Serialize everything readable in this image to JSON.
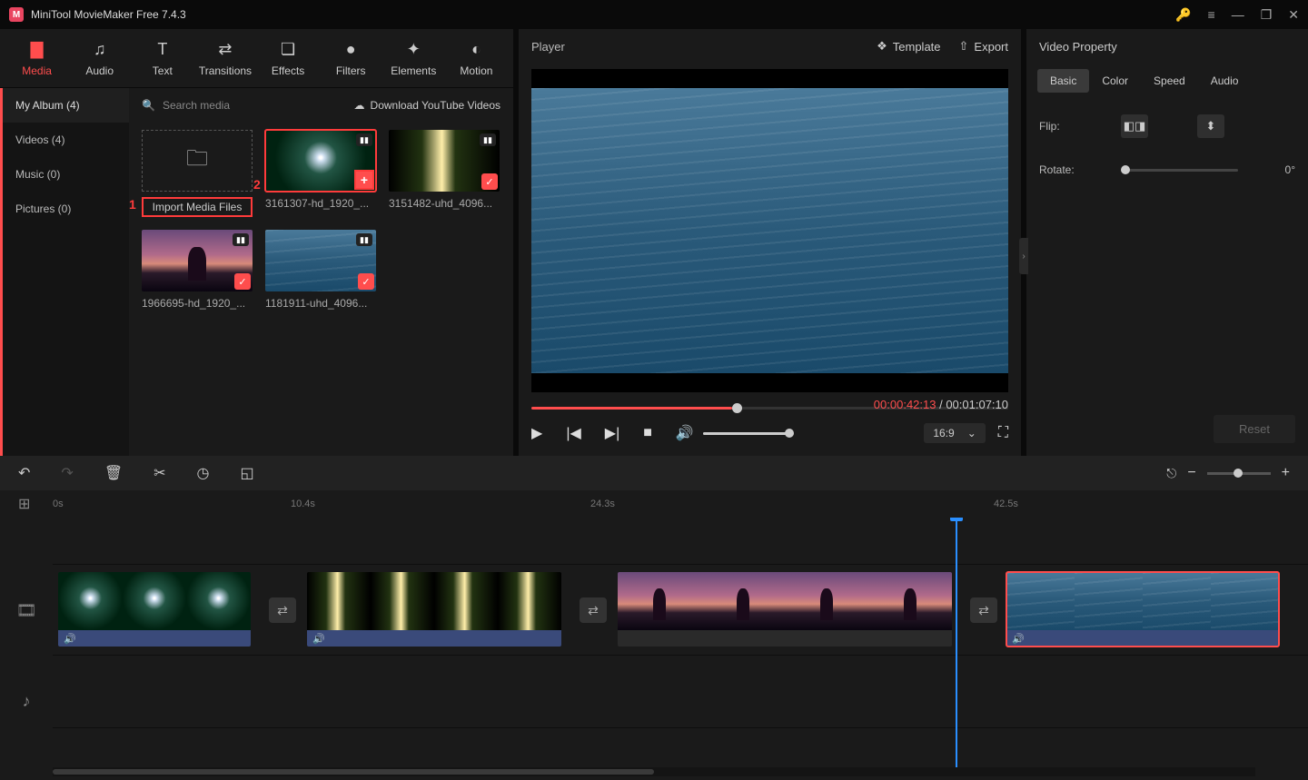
{
  "app": {
    "title": "MiniTool MovieMaker Free 7.4.3"
  },
  "topTabs": {
    "media": "Media",
    "audio": "Audio",
    "text": "Text",
    "transitions": "Transitions",
    "effects": "Effects",
    "filters": "Filters",
    "elements": "Elements",
    "motion": "Motion"
  },
  "sidebar": {
    "myAlbum": "My Album (4)",
    "videos": "Videos (4)",
    "music": "Music (0)",
    "pictures": "Pictures (0)"
  },
  "mediaHeader": {
    "searchPlaceholder": "Search media",
    "download": "Download YouTube Videos"
  },
  "mediaItems": {
    "import": "Import Media Files",
    "annot1": "1",
    "annot2": "2",
    "i1": "3161307-hd_1920_...",
    "i2": "3151482-uhd_4096...",
    "i3": "1966695-hd_1920_...",
    "i4": "1181911-uhd_4096..."
  },
  "player": {
    "title": "Player",
    "template": "Template",
    "export": "Export",
    "timeCurrent": "00:00:42:13",
    "timeTotal": " / 00:01:07:10",
    "ratio": "16:9"
  },
  "props": {
    "title": "Video Property",
    "tabs": {
      "basic": "Basic",
      "color": "Color",
      "speed": "Speed",
      "audio": "Audio"
    },
    "flip": "Flip:",
    "rotate": "Rotate:",
    "rotateVal": "0°",
    "reset": "Reset"
  },
  "timeline": {
    "t0": "0s",
    "t1": "10.4s",
    "t2": "24.3s",
    "t3": "42.5s"
  }
}
